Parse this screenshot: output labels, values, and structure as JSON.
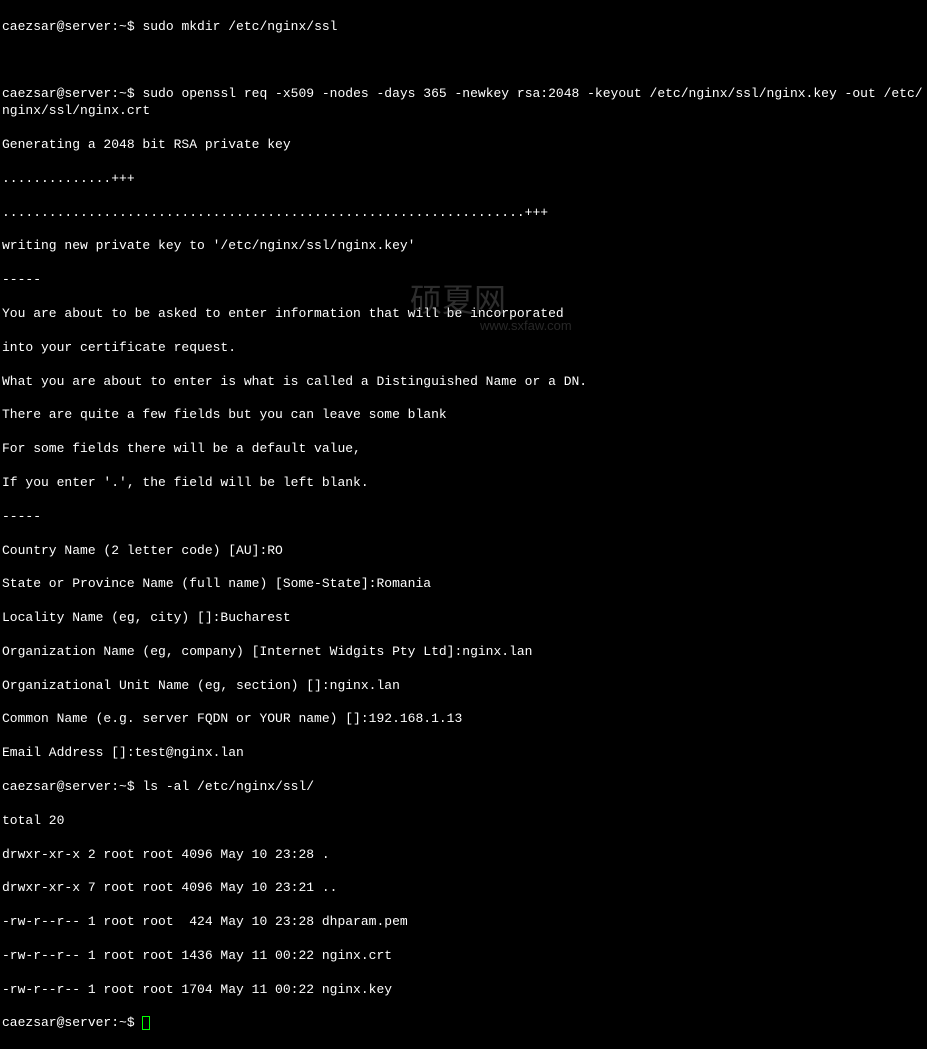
{
  "prompt": "caezsar@server:~$ ",
  "commands": {
    "mkdir": "sudo mkdir /etc/nginx/ssl",
    "openssl": "sudo openssl req -x509 -nodes -days 365 -newkey rsa:2048 -keyout /etc/nginx/ssl/nginx.key -out /etc/nginx/ssl/nginx.crt",
    "ls": "ls -al /etc/nginx/ssl/"
  },
  "output": {
    "generating": "Generating a 2048 bit RSA private key",
    "dots1": "..............+++",
    "dots2": "...................................................................+++",
    "writing": "writing new private key to '/etc/nginx/ssl/nginx.key'",
    "sep": "-----",
    "info1": "You are about to be asked to enter information that will be incorporated",
    "info2": "into your certificate request.",
    "info3": "What you are about to enter is what is called a Distinguished Name or a DN.",
    "info4": "There are quite a few fields but you can leave some blank",
    "info5": "For some fields there will be a default value,",
    "info6": "If you enter '.', the field will be left blank.",
    "country": "Country Name (2 letter code) [AU]:RO",
    "state": "State or Province Name (full name) [Some-State]:Romania",
    "locality": "Locality Name (eg, city) []:Bucharest",
    "org": "Organization Name (eg, company) [Internet Widgits Pty Ltd]:nginx.lan",
    "orgunit": "Organizational Unit Name (eg, section) []:nginx.lan",
    "common": "Common Name (e.g. server FQDN or YOUR name) []:192.168.1.13",
    "email": "Email Address []:test@nginx.lan"
  },
  "ls_output": {
    "total": "total 20",
    "rows": [
      "drwxr-xr-x 2 root root 4096 May 10 23:28 .",
      "drwxr-xr-x 7 root root 4096 May 10 23:21 ..",
      "-rw-r--r-- 1 root root  424 May 10 23:28 dhparam.pem",
      "-rw-r--r-- 1 root root 1436 May 11 00:22 nginx.crt",
      "-rw-r--r-- 1 root root 1704 May 11 00:22 nginx.key"
    ]
  },
  "watermark": {
    "main": "硕夏网",
    "sub": "www.sxfaw.com"
  }
}
